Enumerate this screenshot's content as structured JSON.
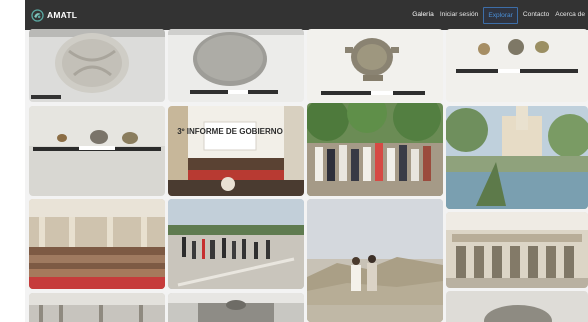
{
  "navbar": {
    "brand": "AMATL",
    "links": [
      "Galería",
      "Iniciar sesión",
      "Explorar",
      "Contacto",
      "Acerca de"
    ],
    "active_link": "Explorar"
  },
  "gallery": {
    "photos": [
      {
        "subject": "carved stone fragment"
      },
      {
        "subject": "round stone disk"
      },
      {
        "subject": "stone artifact with handles"
      },
      {
        "subject": "three small stones"
      },
      {
        "subject": "three small stones on table"
      },
      {
        "subject": "ceremony stage"
      },
      {
        "subject": "crowd gathering under trees"
      },
      {
        "subject": "plaza with church and trees"
      },
      {
        "subject": "assembly in hall"
      },
      {
        "subject": "procession on field"
      },
      {
        "subject": "two people on hillside"
      },
      {
        "subject": "building facade with arches"
      },
      {
        "subject": "colonnade"
      },
      {
        "subject": "building with dome"
      },
      {
        "subject": "stone object"
      }
    ]
  },
  "sign_text": {
    "informe": "3º INFORME DE GOBIERNO"
  },
  "colors": {
    "navbar_bg": "#333333",
    "page_bg": "#f3f3f3",
    "active_link": "#4a8fd6"
  }
}
